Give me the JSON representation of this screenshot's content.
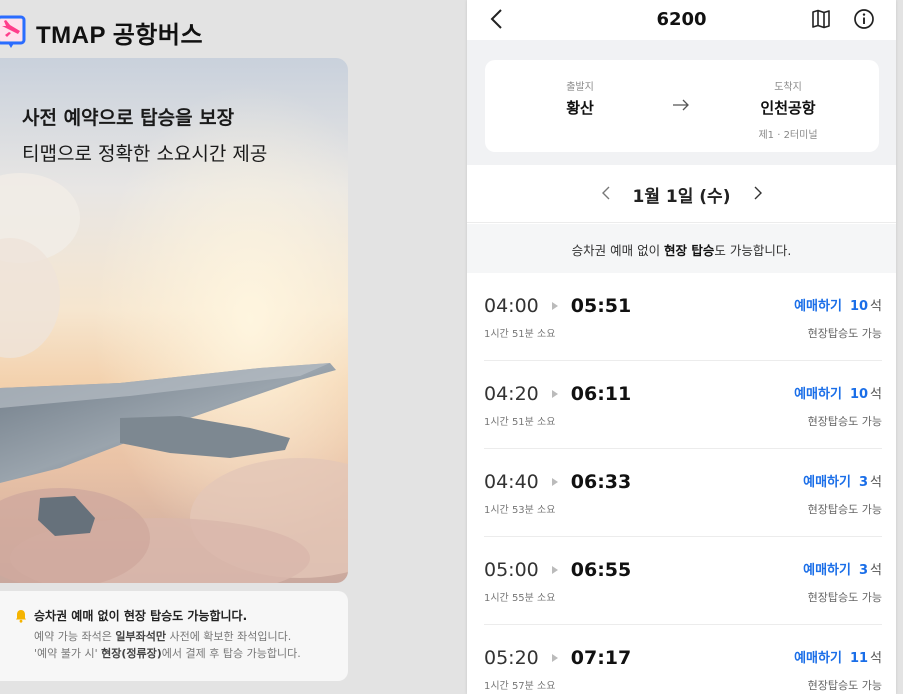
{
  "brand": {
    "name": "TMAP 공항버스"
  },
  "hero": {
    "title": "사전 예약으로 탑승을 보장",
    "subtitle": "티맵으로 정확한 소요시간 제공"
  },
  "notice": {
    "title": "승차권 예매 없이 현장 탑승도 가능합니다.",
    "line1_a": "예약 가능 좌석은 ",
    "line1_b": "일부좌석만",
    "line1_c": " 사전에 확보한 좌석입니다.",
    "line2_a": "'예약 불가 시' ",
    "line2_b": "현장(정류장)",
    "line2_c": "에서 결제 후 탑승 가능합니다."
  },
  "topbar": {
    "route_number": "6200"
  },
  "route": {
    "origin_caption": "출발지",
    "origin_name": "황산",
    "dest_caption": "도착지",
    "dest_name": "인천공항",
    "dest_sub": "제1 · 2터미널"
  },
  "date": {
    "label": "1월 1일 (수)"
  },
  "banner": {
    "a": "승차권 예매 없이 ",
    "b": "현장 탑승",
    "c": "도 가능합니다."
  },
  "schedule": [
    {
      "depart": "04:00",
      "arrive": "05:51",
      "duration": "1시간 51분 소요",
      "book": "예매하기",
      "seats": "10",
      "unit": "석",
      "onsite": "현장탑승도 가능"
    },
    {
      "depart": "04:20",
      "arrive": "06:11",
      "duration": "1시간 51분 소요",
      "book": "예매하기",
      "seats": "10",
      "unit": "석",
      "onsite": "현장탑승도 가능"
    },
    {
      "depart": "04:40",
      "arrive": "06:33",
      "duration": "1시간 53분 소요",
      "book": "예매하기",
      "seats": "3",
      "unit": "석",
      "onsite": "현장탑승도 가능"
    },
    {
      "depart": "05:00",
      "arrive": "06:55",
      "duration": "1시간 55분 소요",
      "book": "예매하기",
      "seats": "3",
      "unit": "석",
      "onsite": "현장탑승도 가능"
    },
    {
      "depart": "05:20",
      "arrive": "07:17",
      "duration": "1시간 57분 소요",
      "book": "예매하기",
      "seats": "11",
      "unit": "석",
      "onsite": "현장탑승도 가능"
    }
  ],
  "colors": {
    "accent": "#1a6ee8",
    "bell": "#f5b400",
    "logo_pink": "#ff3d8b",
    "logo_blue": "#2b6cff"
  },
  "icons": [
    "tmap-logo-icon",
    "bell-icon",
    "back-icon",
    "map-icon",
    "info-icon",
    "arrow-right-icon",
    "chevron-left-icon",
    "chevron-right-icon",
    "play-icon"
  ]
}
